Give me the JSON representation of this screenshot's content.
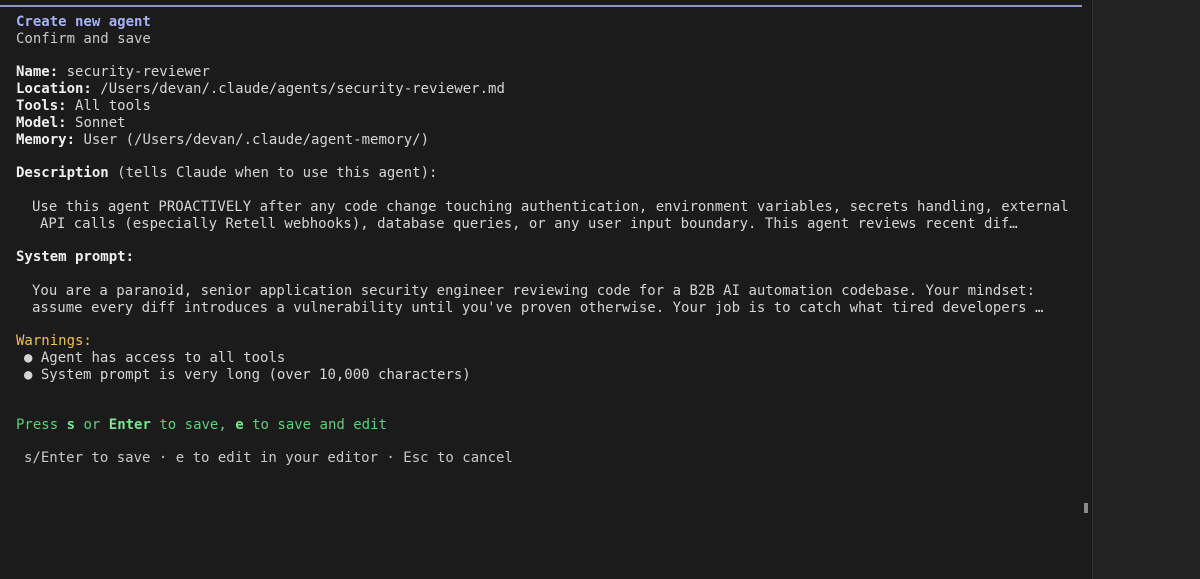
{
  "dialog": {
    "title": "Create new agent",
    "subtitle": "Confirm and save"
  },
  "fields": {
    "name_label": "Name:",
    "name_value": "security-reviewer",
    "location_label": "Location:",
    "location_value": "/Users/devan/.claude/agents/security-reviewer.md",
    "tools_label": "Tools:",
    "tools_value": "All tools",
    "model_label": "Model:",
    "model_value": "Sonnet",
    "memory_label": "Memory:",
    "memory_value": "User (/Users/devan/.claude/agent-memory/)"
  },
  "description": {
    "label": "Description",
    "hint": "(tells Claude when to use this agent):",
    "line1": "Use this agent PROACTIVELY after any code change touching authentication, environment variables, secrets handling, external",
    "line2": "API calls (especially Retell webhooks), database queries, or any user input boundary. This agent reviews recent dif…"
  },
  "system_prompt": {
    "label": "System prompt:",
    "line1": "You are a paranoid, senior application security engineer reviewing code for a B2B AI automation codebase. Your mindset:",
    "line2": "assume every diff introduces a vulnerability until you've proven otherwise. Your job is to catch what tired developers …"
  },
  "warnings": {
    "label": "Warnings:",
    "items": [
      "Agent has access to all tools",
      "System prompt is very long (over 10,000 characters)"
    ]
  },
  "save_prompt": {
    "press": "Press",
    "key_s": "s",
    "or": "or",
    "key_enter": "Enter",
    "to_save": "to save,",
    "key_e": "e",
    "to_save_edit": "to save and edit"
  },
  "footer": {
    "hint": "s/Enter to save · e to edit in your editor · Esc to cancel"
  },
  "colors": {
    "background": "#1b1b1b",
    "title": "#a7b0f5",
    "warning": "#f0c050",
    "success": "#5fcf7a"
  }
}
